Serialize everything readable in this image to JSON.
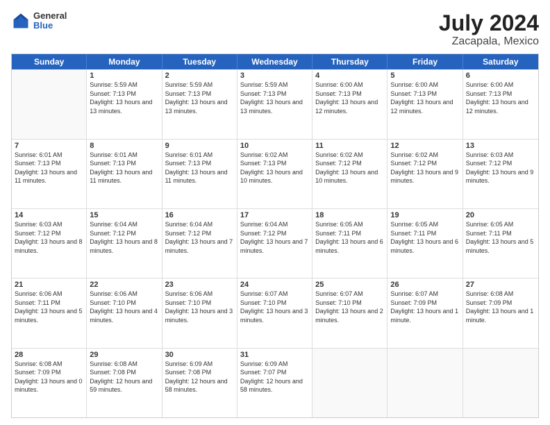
{
  "logo": {
    "line1": "General",
    "line2": "Blue"
  },
  "title": "July 2024",
  "subtitle": "Zacapala, Mexico",
  "header_days": [
    "Sunday",
    "Monday",
    "Tuesday",
    "Wednesday",
    "Thursday",
    "Friday",
    "Saturday"
  ],
  "rows": [
    [
      {
        "day": "",
        "empty": true
      },
      {
        "day": "1",
        "sunrise": "Sunrise: 5:59 AM",
        "sunset": "Sunset: 7:13 PM",
        "daylight": "Daylight: 13 hours and 13 minutes."
      },
      {
        "day": "2",
        "sunrise": "Sunrise: 5:59 AM",
        "sunset": "Sunset: 7:13 PM",
        "daylight": "Daylight: 13 hours and 13 minutes."
      },
      {
        "day": "3",
        "sunrise": "Sunrise: 5:59 AM",
        "sunset": "Sunset: 7:13 PM",
        "daylight": "Daylight: 13 hours and 13 minutes."
      },
      {
        "day": "4",
        "sunrise": "Sunrise: 6:00 AM",
        "sunset": "Sunset: 7:13 PM",
        "daylight": "Daylight: 13 hours and 12 minutes."
      },
      {
        "day": "5",
        "sunrise": "Sunrise: 6:00 AM",
        "sunset": "Sunset: 7:13 PM",
        "daylight": "Daylight: 13 hours and 12 minutes."
      },
      {
        "day": "6",
        "sunrise": "Sunrise: 6:00 AM",
        "sunset": "Sunset: 7:13 PM",
        "daylight": "Daylight: 13 hours and 12 minutes."
      }
    ],
    [
      {
        "day": "7",
        "sunrise": "Sunrise: 6:01 AM",
        "sunset": "Sunset: 7:13 PM",
        "daylight": "Daylight: 13 hours and 11 minutes."
      },
      {
        "day": "8",
        "sunrise": "Sunrise: 6:01 AM",
        "sunset": "Sunset: 7:13 PM",
        "daylight": "Daylight: 13 hours and 11 minutes."
      },
      {
        "day": "9",
        "sunrise": "Sunrise: 6:01 AM",
        "sunset": "Sunset: 7:13 PM",
        "daylight": "Daylight: 13 hours and 11 minutes."
      },
      {
        "day": "10",
        "sunrise": "Sunrise: 6:02 AM",
        "sunset": "Sunset: 7:13 PM",
        "daylight": "Daylight: 13 hours and 10 minutes."
      },
      {
        "day": "11",
        "sunrise": "Sunrise: 6:02 AM",
        "sunset": "Sunset: 7:12 PM",
        "daylight": "Daylight: 13 hours and 10 minutes."
      },
      {
        "day": "12",
        "sunrise": "Sunrise: 6:02 AM",
        "sunset": "Sunset: 7:12 PM",
        "daylight": "Daylight: 13 hours and 9 minutes."
      },
      {
        "day": "13",
        "sunrise": "Sunrise: 6:03 AM",
        "sunset": "Sunset: 7:12 PM",
        "daylight": "Daylight: 13 hours and 9 minutes."
      }
    ],
    [
      {
        "day": "14",
        "sunrise": "Sunrise: 6:03 AM",
        "sunset": "Sunset: 7:12 PM",
        "daylight": "Daylight: 13 hours and 8 minutes."
      },
      {
        "day": "15",
        "sunrise": "Sunrise: 6:04 AM",
        "sunset": "Sunset: 7:12 PM",
        "daylight": "Daylight: 13 hours and 8 minutes."
      },
      {
        "day": "16",
        "sunrise": "Sunrise: 6:04 AM",
        "sunset": "Sunset: 7:12 PM",
        "daylight": "Daylight: 13 hours and 7 minutes."
      },
      {
        "day": "17",
        "sunrise": "Sunrise: 6:04 AM",
        "sunset": "Sunset: 7:12 PM",
        "daylight": "Daylight: 13 hours and 7 minutes."
      },
      {
        "day": "18",
        "sunrise": "Sunrise: 6:05 AM",
        "sunset": "Sunset: 7:11 PM",
        "daylight": "Daylight: 13 hours and 6 minutes."
      },
      {
        "day": "19",
        "sunrise": "Sunrise: 6:05 AM",
        "sunset": "Sunset: 7:11 PM",
        "daylight": "Daylight: 13 hours and 6 minutes."
      },
      {
        "day": "20",
        "sunrise": "Sunrise: 6:05 AM",
        "sunset": "Sunset: 7:11 PM",
        "daylight": "Daylight: 13 hours and 5 minutes."
      }
    ],
    [
      {
        "day": "21",
        "sunrise": "Sunrise: 6:06 AM",
        "sunset": "Sunset: 7:11 PM",
        "daylight": "Daylight: 13 hours and 5 minutes."
      },
      {
        "day": "22",
        "sunrise": "Sunrise: 6:06 AM",
        "sunset": "Sunset: 7:10 PM",
        "daylight": "Daylight: 13 hours and 4 minutes."
      },
      {
        "day": "23",
        "sunrise": "Sunrise: 6:06 AM",
        "sunset": "Sunset: 7:10 PM",
        "daylight": "Daylight: 13 hours and 3 minutes."
      },
      {
        "day": "24",
        "sunrise": "Sunrise: 6:07 AM",
        "sunset": "Sunset: 7:10 PM",
        "daylight": "Daylight: 13 hours and 3 minutes."
      },
      {
        "day": "25",
        "sunrise": "Sunrise: 6:07 AM",
        "sunset": "Sunset: 7:10 PM",
        "daylight": "Daylight: 13 hours and 2 minutes."
      },
      {
        "day": "26",
        "sunrise": "Sunrise: 6:07 AM",
        "sunset": "Sunset: 7:09 PM",
        "daylight": "Daylight: 13 hours and 1 minute."
      },
      {
        "day": "27",
        "sunrise": "Sunrise: 6:08 AM",
        "sunset": "Sunset: 7:09 PM",
        "daylight": "Daylight: 13 hours and 1 minute."
      }
    ],
    [
      {
        "day": "28",
        "sunrise": "Sunrise: 6:08 AM",
        "sunset": "Sunset: 7:09 PM",
        "daylight": "Daylight: 13 hours and 0 minutes."
      },
      {
        "day": "29",
        "sunrise": "Sunrise: 6:08 AM",
        "sunset": "Sunset: 7:08 PM",
        "daylight": "Daylight: 12 hours and 59 minutes."
      },
      {
        "day": "30",
        "sunrise": "Sunrise: 6:09 AM",
        "sunset": "Sunset: 7:08 PM",
        "daylight": "Daylight: 12 hours and 58 minutes."
      },
      {
        "day": "31",
        "sunrise": "Sunrise: 6:09 AM",
        "sunset": "Sunset: 7:07 PM",
        "daylight": "Daylight: 12 hours and 58 minutes."
      },
      {
        "day": "",
        "empty": true
      },
      {
        "day": "",
        "empty": true
      },
      {
        "day": "",
        "empty": true
      }
    ]
  ]
}
